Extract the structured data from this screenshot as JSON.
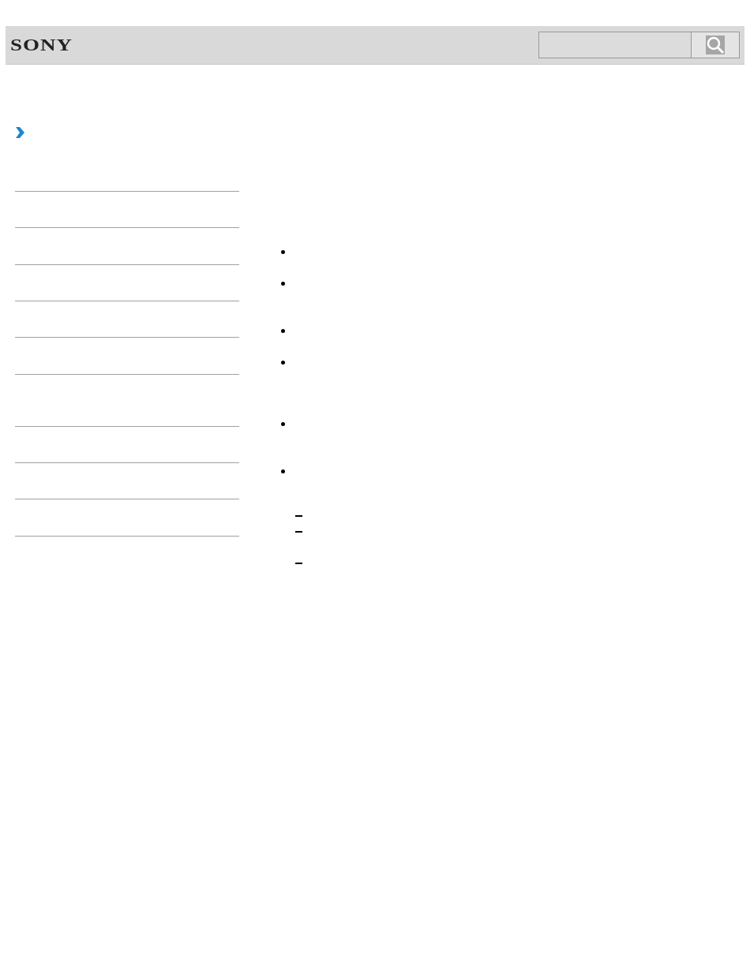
{
  "header": {
    "logo": "SONY"
  },
  "content": {
    "items": [
      {
        "kind": "bullet"
      },
      {
        "kind": "bullet"
      },
      {
        "kind": "bullet"
      },
      {
        "kind": "bullet"
      },
      {
        "kind": "bullet"
      },
      {
        "kind": "bullet",
        "children": [
          {
            "kind": "dash"
          },
          {
            "kind": "dash"
          },
          {
            "kind": "dash"
          }
        ]
      }
    ]
  }
}
